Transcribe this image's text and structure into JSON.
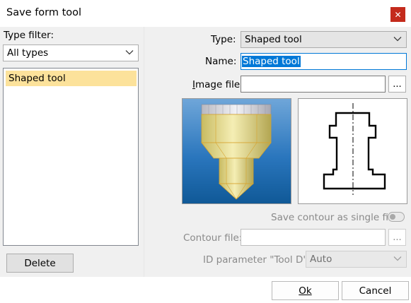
{
  "window": {
    "title": "Save form tool",
    "close_glyph": "✕"
  },
  "left_panel": {
    "type_filter_label": "Type filter:",
    "type_filter_value": "All types",
    "list_items": [
      "Shaped tool"
    ],
    "delete_label": "Delete"
  },
  "form": {
    "type_label": "Type:",
    "type_value": "Shaped tool",
    "name_label": "Name:",
    "name_value": "Shaped tool",
    "image_file_label": "Image file:",
    "image_file_value": "",
    "browse_label": "...",
    "save_contour_label": "Save contour as single file",
    "save_contour_checked": false,
    "contour_file_label": "Contour file:",
    "contour_file_value": "",
    "id_param_label": "ID parameter \"Tool D\":",
    "id_param_value": "Auto"
  },
  "footer": {
    "ok_label": "Ok",
    "cancel_label": "Cancel"
  },
  "colors": {
    "close_button": "#c42b1c",
    "list_selection": "#fce29b",
    "text_selection": "#0078d7",
    "preview_background": "#1f6fb6",
    "tool_body": "#e8dc8c"
  },
  "icons": {
    "close": "close-icon",
    "dropdown": "chevron-down-icon",
    "preview": "shaped-tool-image",
    "contour": "tool-contour-drawing"
  }
}
